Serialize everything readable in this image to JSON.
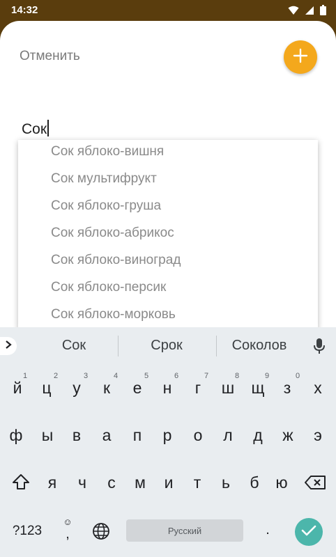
{
  "status_bar": {
    "time": "14:32"
  },
  "header": {
    "cancel_label": "Отменить",
    "add_button_icon": "plus-icon"
  },
  "search": {
    "value": "Сок"
  },
  "suggestions_dropdown": {
    "items": [
      "Сок яблоко-вишня",
      "Сок мультифрукт",
      "Сок яблоко-груша",
      "Сок яблоко-абрикос",
      "Сок яблоко-виноград",
      "Сок яблоко-персик",
      "Сок яблоко-морковь"
    ]
  },
  "keyboard": {
    "suggestions": [
      "Сок",
      "Срок",
      "Соколов"
    ],
    "row1": [
      "й",
      "ц",
      "у",
      "к",
      "е",
      "н",
      "г",
      "ш",
      "щ",
      "з",
      "х"
    ],
    "row1_hints": [
      "1",
      "2",
      "3",
      "4",
      "5",
      "6",
      "7",
      "8",
      "9",
      "0"
    ],
    "row2": [
      "ф",
      "ы",
      "в",
      "а",
      "п",
      "р",
      "о",
      "л",
      "д",
      "ж",
      "э"
    ],
    "row3": [
      "я",
      "ч",
      "с",
      "м",
      "и",
      "т",
      "ь",
      "б",
      "ю"
    ],
    "symbols_label": "?123",
    "comma": ",",
    "period": ".",
    "space_label": "Русский"
  },
  "colors": {
    "status_bar": "#5a3d0d",
    "fab": "#f4a81c",
    "enter_key": "#4cb6ab",
    "keyboard_bg": "#e9edf0"
  }
}
